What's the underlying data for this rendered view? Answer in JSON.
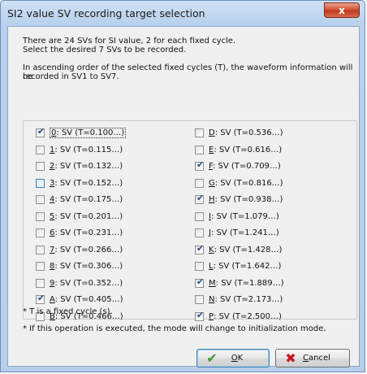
{
  "window": {
    "title": "SI2 value SV recording target selection",
    "close_glyph": "x"
  },
  "message": {
    "line1": "There are 24 SVs for SI value, 2 for each fixed cycle.",
    "line2": "Select the desired 7 SVs to be recorded.",
    "line3": "In ascending order of the selected fixed cycles (T), the waveform information will be",
    "line4": "recorded in SV1 to SV7."
  },
  "left_items": [
    {
      "key": "0",
      "rest": ": SV (T=0.100…)",
      "checked": true,
      "focused": true
    },
    {
      "key": "1",
      "rest": ": SV (T=0.115…)",
      "checked": false
    },
    {
      "key": "2",
      "rest": ": SV (T=0.132…)",
      "checked": false
    },
    {
      "key": "3",
      "rest": ": SV (T=0.152…)",
      "checked": false,
      "hover": true
    },
    {
      "key": "4",
      "rest": ": SV (T=0.175…)",
      "checked": false
    },
    {
      "key": "5",
      "rest": ": SV (T=0.201…)",
      "checked": false
    },
    {
      "key": "6",
      "rest": ": SV (T=0.231…)",
      "checked": false
    },
    {
      "key": "7",
      "rest": ": SV (T=0.266…)",
      "checked": false
    },
    {
      "key": "8",
      "rest": ": SV (T=0.306…)",
      "checked": false
    },
    {
      "key": "9",
      "rest": ": SV (T=0.352…)",
      "checked": false
    },
    {
      "key": "A",
      "rest": ": SV (T=0.405…)",
      "checked": true
    },
    {
      "key": "B",
      "rest": ": SV (T=0.466…)",
      "checked": false
    }
  ],
  "right_items": [
    {
      "key": "D",
      "rest": ": SV (T=0.536…)",
      "checked": false
    },
    {
      "key": "E",
      "rest": ": SV (T=0.616…)",
      "checked": false
    },
    {
      "key": "F",
      "rest": ": SV (T=0.709…)",
      "checked": true
    },
    {
      "key": "G",
      "rest": ": SV (T=0.816…)",
      "checked": false
    },
    {
      "key": "H",
      "rest": ": SV (T=0.938…)",
      "checked": true
    },
    {
      "key": "I",
      "rest": ": SV (T=1.079…)",
      "checked": false
    },
    {
      "key": "J",
      "rest": ": SV (T=1.241…)",
      "checked": false
    },
    {
      "key": "K",
      "rest": ": SV (T=1.428…)",
      "checked": true
    },
    {
      "key": "L",
      "rest": ": SV (T=1.642…)",
      "checked": false
    },
    {
      "key": "M",
      "rest": ": SV (T=1.889…)",
      "checked": true
    },
    {
      "key": "N",
      "rest": ": SV (T=2.173…)",
      "checked": false
    },
    {
      "key": "P",
      "rest": ": SV (T=2.500…)",
      "checked": true
    }
  ],
  "notes": {
    "note1": "* T is a fixed cycle (s).",
    "note2": "* If this operation is executed, the mode will change to initialization mode."
  },
  "buttons": {
    "ok": {
      "key": "O",
      "rest": "K",
      "icon": "check-icon",
      "glyph": "✔"
    },
    "cancel": {
      "key": "C",
      "rest": "ancel",
      "icon": "cross-icon",
      "glyph": "✖"
    }
  },
  "colors": {
    "ok_icon": "#3c9a2c",
    "cancel_icon": "#c8161d"
  }
}
